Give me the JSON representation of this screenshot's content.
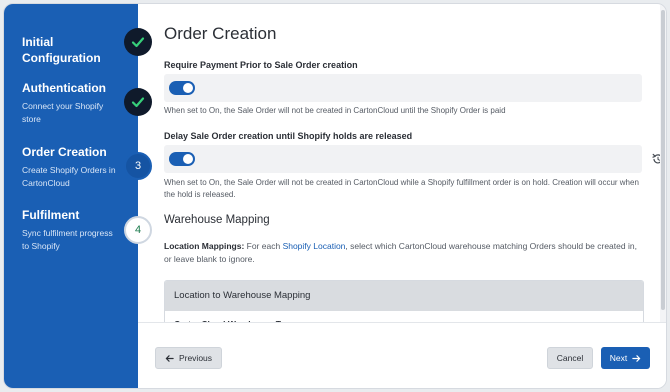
{
  "colors": {
    "sidebar": "#1a5fb4",
    "primary": "#1a5fb4",
    "check": "#37d07a"
  },
  "steps": [
    {
      "title": "Initial Configuration",
      "subtitle": "",
      "status": "done",
      "icon": "check-icon"
    },
    {
      "title": "Authentication",
      "subtitle": "Connect your Shopify store",
      "status": "done",
      "icon": "check-icon"
    },
    {
      "title": "Order Creation",
      "subtitle": "Create Shopify Orders in CartonCloud",
      "status": "current",
      "number": "3"
    },
    {
      "title": "Fulfilment",
      "subtitle": "Sync fulfilment progress to Shopify",
      "status": "todo",
      "number": "4"
    }
  ],
  "main": {
    "title": "Order Creation",
    "require_payment": {
      "label": "Require Payment Prior to Sale Order creation",
      "enabled": true,
      "help": "When set to On, the Sale Order will not be created in CartonCloud until the Shopify Order is paid"
    },
    "delay_holds": {
      "label": "Delay Sale Order creation until Shopify holds are released",
      "enabled": true,
      "help": "When set to On, the Sale Order will not be created in CartonCloud while a Shopify fulfillment order is on hold. Creation will occur when the hold is released.",
      "reset_icon": "reset-icon"
    },
    "warehouse": {
      "section_title": "Warehouse Mapping",
      "label_strong": "Location Mappings:",
      "text_before": " For each ",
      "link_text": "Shopify Location",
      "text_after": ", select which CartonCloud warehouse matching Orders should be created in, or leave blank to ignore.",
      "card_header": "Location to Warehouse Mapping",
      "card_row": "CartonCloud Warehouse Two"
    }
  },
  "footer": {
    "previous_label": "Previous",
    "cancel_label": "Cancel",
    "next_label": "Next"
  }
}
